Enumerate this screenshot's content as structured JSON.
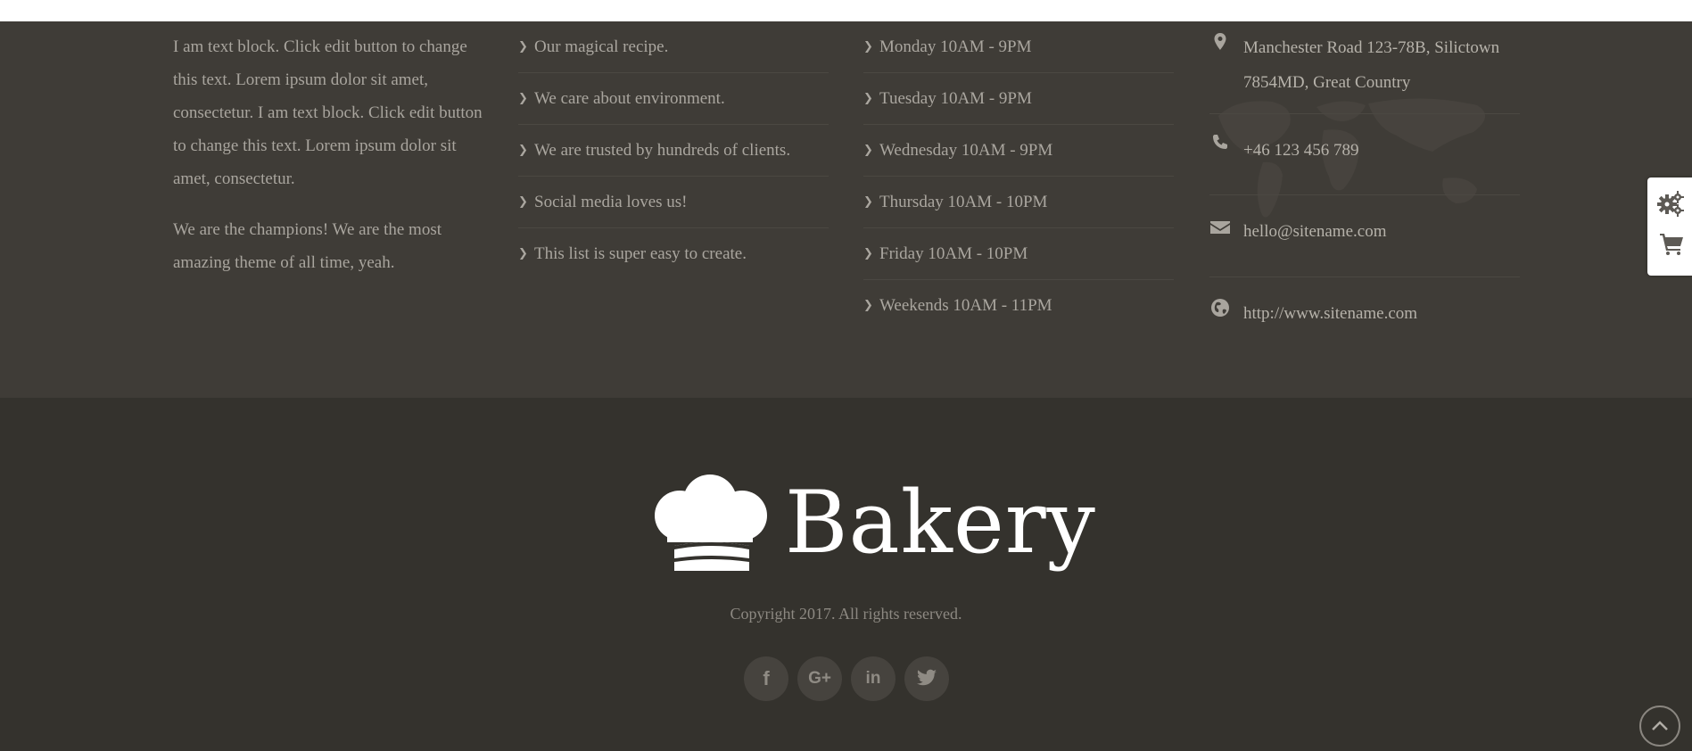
{
  "about": {
    "paragraph1": "I am text block. Click edit button to change this text. Lorem ipsum dolor sit amet, consectetur. I am text block. Click edit button to change this text. Lorem ipsum dolor sit amet, consectetur.",
    "paragraph2": "We are the champions! We are the most amazing theme of all time, yeah."
  },
  "features": [
    "Our magical recipe.",
    "We care about environment.",
    "We are trusted by hundreds of clients.",
    "Social media loves us!",
    "This list is super easy to create."
  ],
  "hours": [
    "Monday 10AM - 9PM",
    "Tuesday 10AM - 9PM",
    "Wednesday 10AM - 9PM",
    "Thursday 10AM - 10PM",
    "Friday 10AM - 10PM",
    "Weekends 10AM - 11PM"
  ],
  "contact": {
    "address": "Manchester Road 123-78B, Silictown 7854MD, Great Country",
    "phone": "+46 123 456 789",
    "email": "hello@sitename.com",
    "website": "http://www.sitename.com"
  },
  "footer": {
    "logo_text": "Bakery",
    "copyright": "Copyright 2017. All rights reserved.",
    "social": [
      {
        "icon": "facebook-icon",
        "glyph": "f"
      },
      {
        "icon": "google-plus-icon",
        "glyph": "G+"
      },
      {
        "icon": "linkedin-icon",
        "glyph": "in"
      },
      {
        "icon": "twitter-icon",
        "glyph": "t"
      }
    ]
  },
  "colors": {
    "widgets_bg": "#3f3c37",
    "footer_bg": "#34322d",
    "text": "#a9a59e"
  }
}
